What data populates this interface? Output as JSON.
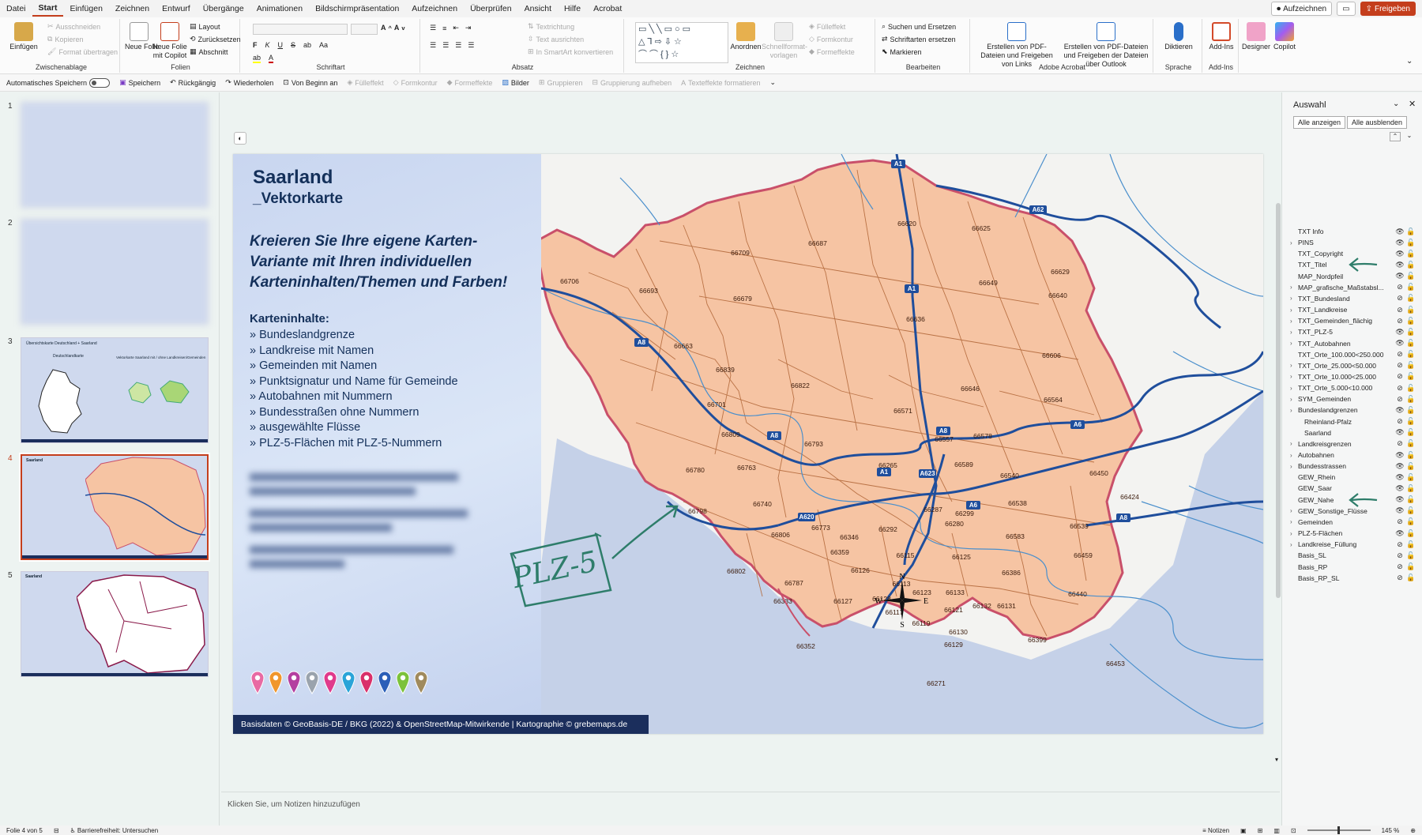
{
  "menubar": {
    "items": [
      "Datei",
      "Start",
      "Einfügen",
      "Zeichnen",
      "Entwurf",
      "Übergänge",
      "Animationen",
      "Bildschirmpräsentation",
      "Aufzeichnen",
      "Überprüfen",
      "Ansicht",
      "Hilfe",
      "Acrobat"
    ],
    "record_label": "Aufzeichnen",
    "share_label": "Freigeben"
  },
  "ribbon": {
    "clipboard": {
      "paste": "Einfügen",
      "cut": "Ausschneiden",
      "copy": "Kopieren",
      "format": "Format übertragen",
      "label": "Zwischenablage"
    },
    "slides": {
      "new": "Neue Folie",
      "copilot": "Neue Folie mit Copilot",
      "layout": "Layout",
      "reset": "Zurücksetzen",
      "section": "Abschnitt",
      "label": "Folien"
    },
    "font": {
      "label": "Schriftart"
    },
    "paragraph": {
      "direction": "Textrichtung",
      "align": "Text ausrichten",
      "smartart": "In SmartArt konvertieren",
      "label": "Absatz"
    },
    "drawing": {
      "arrange": "Anordnen",
      "quickstyles": "Schnellformat-vorlagen",
      "fill": "Fülleffekt",
      "outline": "Formkontur",
      "effects": "Formeffekte",
      "label": "Zeichnen"
    },
    "editing": {
      "find": "Suchen und Ersetzen",
      "replace": "Schriftarten ersetzen",
      "select": "Markieren",
      "label": "Bearbeiten"
    },
    "acrobat": {
      "pdf_links": "Erstellen von PDF-Dateien und Freigeben von Links",
      "pdf_outlook": "Erstellen von PDF-Dateien und Freigeben der Dateien über Outlook",
      "label": "Adobe Acrobat"
    },
    "voice": {
      "dictate": "Diktieren",
      "label": "Sprache"
    },
    "addins": {
      "addins": "Add-Ins",
      "label": "Add-Ins"
    },
    "designer": "Designer",
    "copilot": "Copilot"
  },
  "qat": {
    "autosave": "Automatisches Speichern",
    "save": "Speichern",
    "undo": "Rückgängig",
    "redo": "Wiederholen",
    "from_start": "Von Beginn an",
    "fill": "Fülleffekt",
    "outline": "Formkontur",
    "effects": "Formeffekte",
    "images": "Bilder",
    "group": "Gruppieren",
    "ungroup": "Gruppierung aufheben",
    "texteffects": "Texteffekte formatieren"
  },
  "thumbs": {
    "numbers": [
      "1",
      "2",
      "3",
      "4",
      "5"
    ],
    "t3_title": "Übersichtskarte Deutschland + Saarland",
    "t3_text1": "Deutschlandkarte",
    "t3_text2": "Vektorkarte Saarland mit / ohne Landkreisen/Gemeinden",
    "t4_title": "Saarland",
    "t5_title": "Saarland"
  },
  "slide": {
    "title": "Saarland",
    "subtitle": "_Vektorkarte",
    "headline": [
      "Kreieren Sie Ihre eigene Karten-",
      "Variante mit Ihren individuellen",
      "Karteninhalten/Themen und Farben!"
    ],
    "contents_label": "Karteninhalte:",
    "contents": [
      "» Bundeslandgrenze",
      "» Landkreise mit Namen",
      "» Gemeinden mit Namen",
      "» Punktsignatur und Name für Gemeinde",
      "» Autobahnen mit Nummern",
      "» Bundesstraßen ohne Nummern",
      "» ausgewählte Flüsse",
      "» PLZ-5-Flächen mit PLZ-5-Nummern"
    ],
    "footer": "Basisdaten © GeoBasis-DE / BKG (2022) & OpenStreetMap-Mitwirkende | Kartographie © grebemaps.de",
    "annotation": "PLZ-5",
    "compass": {
      "n": "N",
      "s": "S",
      "e": "E",
      "w": "W"
    },
    "pin_colors": [
      "#e86aa3",
      "#f0962c",
      "#b43fa0",
      "#9aa3ad",
      "#e03a8c",
      "#2aa4d8",
      "#d9306a",
      "#2b5fb8",
      "#7cc23a",
      "#a08a5c"
    ],
    "autobahns": [
      "A1",
      "A62",
      "A1",
      "A8",
      "A8",
      "A8",
      "A1",
      "A623",
      "A6",
      "A620",
      "A6",
      "A8"
    ],
    "plz": [
      "66706",
      "66693",
      "66709",
      "66687",
      "66620",
      "66625",
      "66629",
      "66679",
      "66649",
      "66640",
      "66663",
      "66636",
      "66606",
      "66839",
      "66822",
      "66646",
      "66564",
      "66701",
      "66571",
      "66578",
      "66809",
      "66557",
      "66780",
      "66763",
      "66793",
      "66540",
      "66450",
      "66265",
      "66589",
      "66424",
      "66740",
      "66287",
      "66299",
      "66538",
      "66798",
      "66773",
      "66292",
      "66539",
      "66806",
      "66346",
      "66583",
      "66280",
      "66359",
      "66115",
      "66125",
      "66459",
      "66802",
      "66126",
      "66386",
      "66787",
      "66113",
      "66123",
      "66133",
      "66440",
      "66333",
      "66127",
      "66128",
      "66117",
      "66121",
      "66132",
      "66131",
      "66119",
      "66130",
      "66399",
      "66352",
      "66129",
      "66453",
      "66271"
    ]
  },
  "notes": {
    "placeholder": "Klicken Sie, um Notizen hinzuzufügen"
  },
  "panel": {
    "title": "Auswahl",
    "show_all": "Alle anzeigen",
    "hide_all": "Alle ausblenden",
    "layers": [
      {
        "name": "TXT Info",
        "exp": false,
        "hidden": false
      },
      {
        "name": "PINS",
        "exp": true,
        "hidden": false
      },
      {
        "name": "TXT_Copyright",
        "exp": false,
        "hidden": false
      },
      {
        "name": "TXT_Titel",
        "exp": false,
        "hidden": false
      },
      {
        "name": "MAP_Nordpfeil",
        "exp": false,
        "hidden": false
      },
      {
        "name": "MAP_grafische_Maßstabsl...",
        "exp": true,
        "hidden": true
      },
      {
        "name": "TXT_Bundesland",
        "exp": true,
        "hidden": true
      },
      {
        "name": "TXT_Landkreise",
        "exp": true,
        "hidden": true
      },
      {
        "name": "TXT_Gemeinden_flächig",
        "exp": true,
        "hidden": true
      },
      {
        "name": "TXT_PLZ-5",
        "exp": true,
        "hidden": false
      },
      {
        "name": "TXT_Autobahnen",
        "exp": true,
        "hidden": false
      },
      {
        "name": "TXT_Orte_100.000<250.000",
        "exp": false,
        "hidden": true
      },
      {
        "name": "TXT_Orte_25.000<50.000",
        "exp": true,
        "hidden": true
      },
      {
        "name": "TXT_Orte_10.000<25.000",
        "exp": true,
        "hidden": true
      },
      {
        "name": "TXT_Orte_5.000<10.000",
        "exp": true,
        "hidden": true
      },
      {
        "name": "SYM_Gemeinden",
        "exp": true,
        "hidden": true
      },
      {
        "name": "Bundeslandgrenzen",
        "exp": true,
        "hidden": false
      },
      {
        "name": "Rheinland-Pfalz",
        "exp": false,
        "hidden": true,
        "indent": true
      },
      {
        "name": "Saarland",
        "exp": false,
        "hidden": false,
        "indent": true
      },
      {
        "name": "Landkreisgrenzen",
        "exp": true,
        "hidden": true
      },
      {
        "name": "Autobahnen",
        "exp": true,
        "hidden": false
      },
      {
        "name": "Bundesstrassen",
        "exp": true,
        "hidden": false
      },
      {
        "name": "GEW_Rhein",
        "exp": false,
        "hidden": false
      },
      {
        "name": "GEW_Saar",
        "exp": false,
        "hidden": false
      },
      {
        "name": "GEW_Nahe",
        "exp": false,
        "hidden": false
      },
      {
        "name": "GEW_Sonstige_Flüsse",
        "exp": true,
        "hidden": false
      },
      {
        "name": "Gemeinden",
        "exp": true,
        "hidden": true
      },
      {
        "name": "PLZ-5-Flächen",
        "exp": true,
        "hidden": false
      },
      {
        "name": "Landkreise_Füllung",
        "exp": true,
        "hidden": true
      },
      {
        "name": "Basis_SL",
        "exp": false,
        "hidden": true
      },
      {
        "name": "Basis_RP",
        "exp": false,
        "hidden": true
      },
      {
        "name": "Basis_RP_SL",
        "exp": false,
        "hidden": true
      }
    ]
  },
  "status": {
    "slide": "Folie 4 von 5",
    "accessibility": "Barrierefreiheit: Untersuchen",
    "notes": "Notizen",
    "zoom": "145 %"
  },
  "colors": {
    "accent": "#c43e1c",
    "plz_fill": "#f6c4a3",
    "plz_border": "#c9506a",
    "autobahn": "#1f4e9c",
    "river": "#4a8fcc",
    "footer_bg": "#1b2e5c"
  }
}
